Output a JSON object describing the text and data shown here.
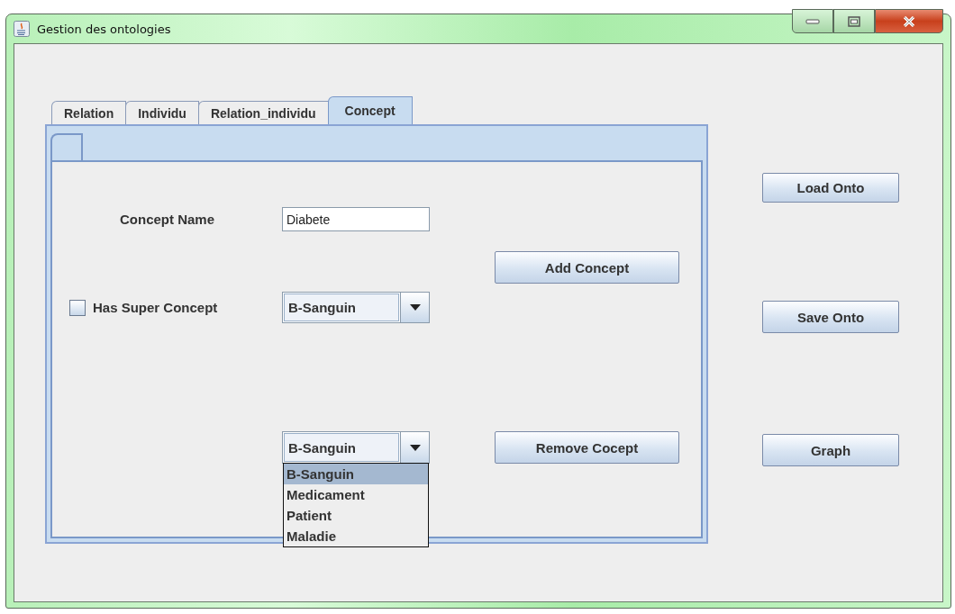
{
  "window": {
    "title": "Gestion des ontologies"
  },
  "tabs": [
    {
      "label": "Relation",
      "selected": false
    },
    {
      "label": "Individu",
      "selected": false
    },
    {
      "label": "Relation_individu",
      "selected": false
    },
    {
      "label": "Concept",
      "selected": true
    }
  ],
  "form": {
    "concept_name_label": "Concept Name",
    "concept_name_value": "Diabete",
    "has_super_concept": {
      "label": "Has Super Concept",
      "checked": false
    },
    "super_concept_combo": {
      "value": "B-Sanguin"
    },
    "add_button": "Add Concept",
    "remove_combo": {
      "value": "B-Sanguin",
      "expanded": true,
      "options": [
        {
          "label": "B-Sanguin",
          "selected": true
        },
        {
          "label": "Medicament",
          "selected": false
        },
        {
          "label": "Patient",
          "selected": false
        },
        {
          "label": "Maladie",
          "selected": false
        }
      ]
    },
    "remove_button": "Remove Cocept"
  },
  "side_buttons": [
    "Load Onto",
    "Save Onto",
    "Graph"
  ]
}
